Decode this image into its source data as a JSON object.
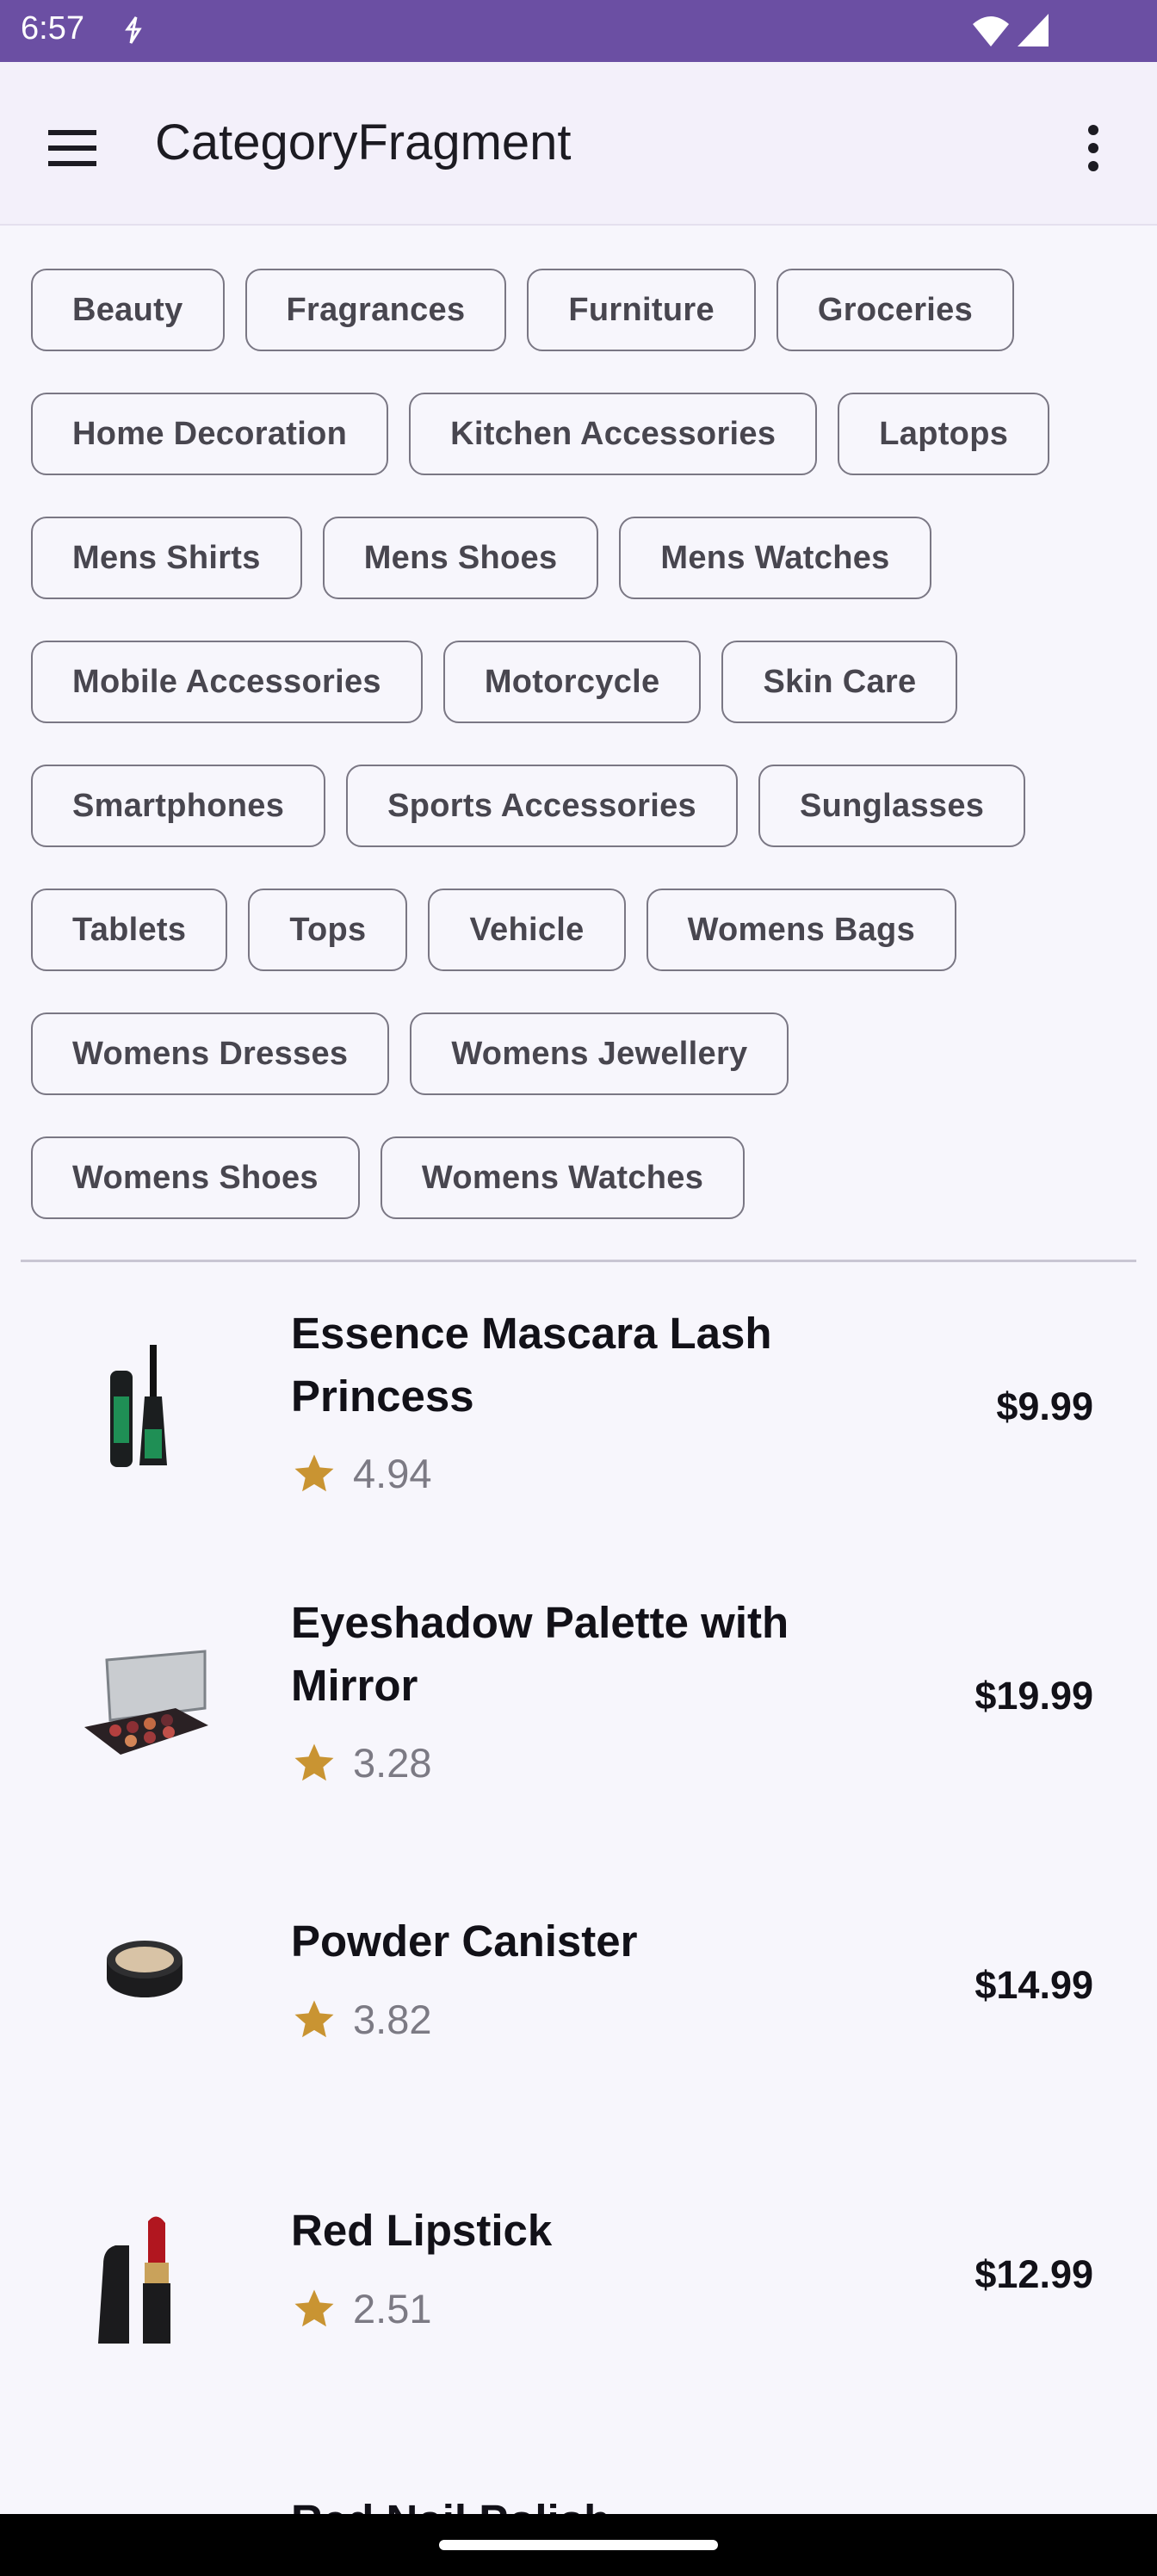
{
  "status_bar": {
    "time": "6:57"
  },
  "app_bar": {
    "title": "CategoryFragment"
  },
  "categories": [
    [
      "Beauty",
      "Fragrances",
      "Furniture",
      "Groceries"
    ],
    [
      "Home Decoration",
      "Kitchen Accessories",
      "Laptops"
    ],
    [
      "Mens Shirts",
      "Mens Shoes",
      "Mens Watches"
    ],
    [
      "Mobile Accessories",
      "Motorcycle",
      "Skin Care"
    ],
    [
      "Smartphones",
      "Sports Accessories",
      "Sunglasses"
    ],
    [
      "Tablets",
      "Tops",
      "Vehicle",
      "Womens Bags"
    ],
    [
      "Womens Dresses",
      "Womens Jewellery"
    ],
    [
      "Womens Shoes",
      "Womens Watches"
    ]
  ],
  "products": [
    {
      "name": "Essence Mascara Lash Princess",
      "rating": "4.94",
      "price": "$9.99",
      "icon": "mascara-icon"
    },
    {
      "name": "Eyeshadow Palette with Mirror",
      "rating": "3.28",
      "price": "$19.99",
      "icon": "eyeshadow-palette-icon"
    },
    {
      "name": "Powder Canister",
      "rating": "3.82",
      "price": "$14.99",
      "icon": "powder-canister-icon"
    },
    {
      "name": "Red Lipstick",
      "rating": "2.51",
      "price": "$12.99",
      "icon": "lipstick-icon"
    }
  ],
  "cutoff_item": "Red Nail Polish",
  "colors": {
    "status_bar": "#6b4fa3",
    "star": "#c99432",
    "chip_border": "#7a7784"
  }
}
